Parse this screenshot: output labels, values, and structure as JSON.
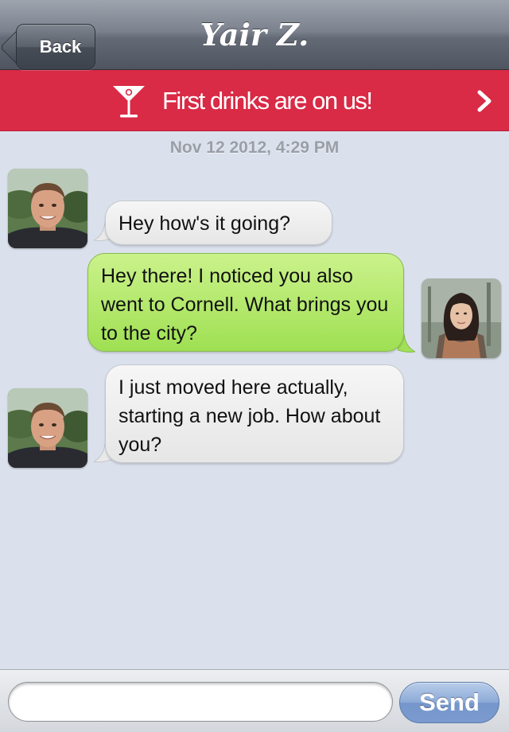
{
  "navbar": {
    "back_label": "Back",
    "title": "Yair Z."
  },
  "promo": {
    "icon": "cocktail-glass-icon",
    "text": "First drinks are on us!",
    "chevron": "chevron-right-icon",
    "color": "#d92a46"
  },
  "chat": {
    "timestamp": "Nov 12 2012, 4:29 PM",
    "messages": [
      {
        "sender": "them",
        "text": "Hey how's it going?"
      },
      {
        "sender": "me",
        "text": "Hey there! I noticed you also went to Cornell. What brings you to the city?"
      },
      {
        "sender": "them",
        "text": "I just moved here actually, starting a new job. How about you?"
      }
    ]
  },
  "composer": {
    "input_value": "",
    "send_label": "Send"
  },
  "colors": {
    "background": "#dbe1ec",
    "incoming_bubble": "#eeeeee",
    "outgoing_bubble": "#b5ea6f",
    "send_button": "#8ca9d6"
  }
}
